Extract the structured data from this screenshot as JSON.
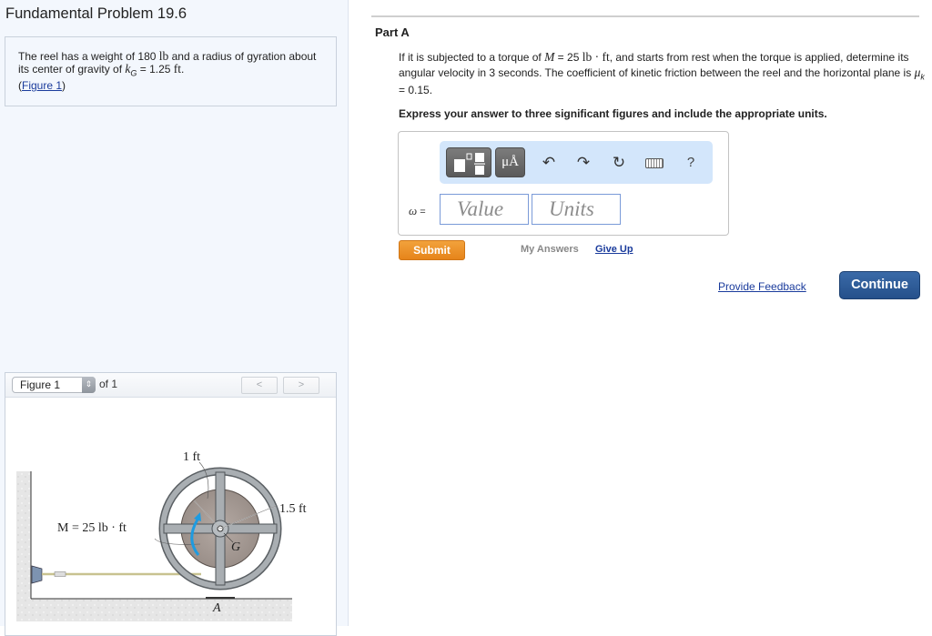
{
  "problem": {
    "title": "Fundamental Problem 19.6",
    "text_1": "The reel has a weight of 180 ",
    "weight_unit": "lb",
    "text_2": " and a radius of gyration about its center of gravity of ",
    "kg_symbol": "k",
    "kg_sub": "G",
    "text_3": " = 1.25 ",
    "kg_unit": "ft",
    "text_4": ".",
    "figure_link_open": "(",
    "figure_link": "Figure 1",
    "figure_link_close": ")"
  },
  "figure_viewer": {
    "selected": "Figure 1",
    "of_label": "of 1",
    "prev_icon": "chevron-left",
    "next_icon": "chevron-right",
    "labels": {
      "inner_radius": "1 ft",
      "outer_radius": "1.5 ft",
      "moment": "M = 25 lb · ft",
      "center": "G",
      "contact": "A"
    }
  },
  "part": {
    "title": "Part A",
    "q_1": "If it is subjected to a torque of ",
    "q_M": "M",
    "q_2": " = 25 ",
    "q_unit": "lb · ft",
    "q_3": ", and starts from rest when the torque is applied, determine its angular velocity in 3 seconds. The coefficient of kinetic friction between the reel and the horizontal plane is ",
    "q_mu": "μ",
    "q_mu_sub": "k",
    "q_4": " = 0.15.",
    "instructions": "Express your answer to three significant figures and include the appropriate units."
  },
  "answer": {
    "toolbar": {
      "templates_icon": "templates-icon",
      "units_label": "μÅ",
      "undo": "↶",
      "redo": "↷",
      "reset": "↻",
      "keyboard_icon": "keyboard-icon",
      "help": "?"
    },
    "variable": "ω",
    "equals": " =",
    "value_placeholder": "Value",
    "units_placeholder": "Units",
    "value": "",
    "units": ""
  },
  "actions": {
    "submit": "Submit",
    "my_answers": "My Answers",
    "give_up": "Give Up",
    "feedback": "Provide Feedback",
    "continue": "Continue"
  },
  "colors": {
    "submit": "#e98c24",
    "continue": "#2e5d9a",
    "link": "#1a3b9c",
    "toolbar_bg": "#d3e6fb",
    "moment_arrow": "#1e9be0"
  }
}
